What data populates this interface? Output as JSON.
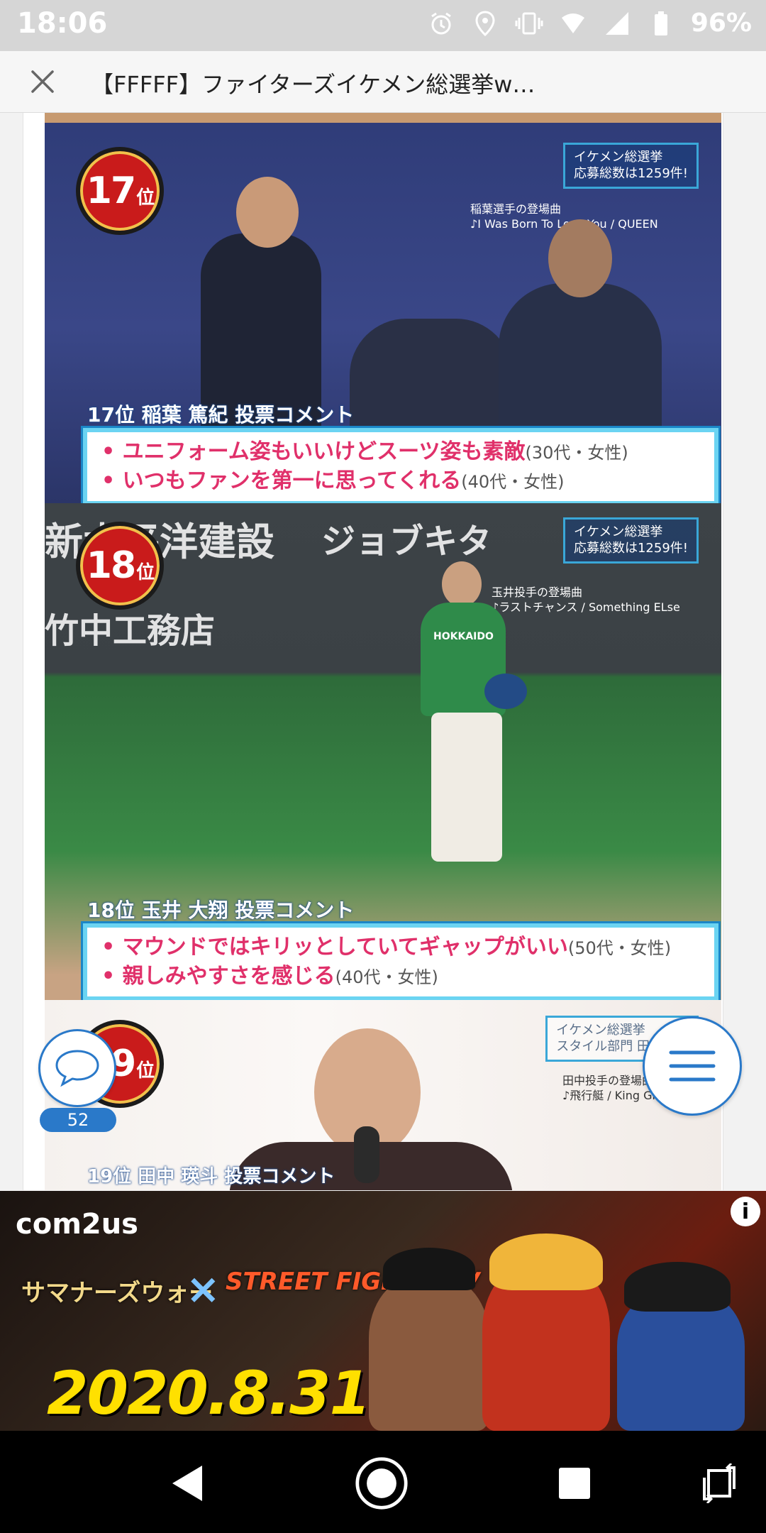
{
  "status_bar": {
    "time": "18:06",
    "battery": "96%",
    "icons": [
      "alarm-icon",
      "location-icon",
      "vibrate-icon",
      "wifi-icon",
      "signal-icon",
      "battery-icon"
    ]
  },
  "header": {
    "title": "【FFFFF】ファイターズイケメン総選挙w…"
  },
  "panels": {
    "p17": {
      "rank_num": "17",
      "rank_suffix": "位",
      "tag_line1": "イケメン総選挙",
      "tag_line2": "応募総数は1259件!",
      "song_label": "稲葉選手の登場曲",
      "song_title": "♪I Was Born To Love You / QUEEN",
      "comment_head": "17位 稲葉 篤紀 投票コメント",
      "comments": [
        {
          "text": "• ユニフォーム姿もいいけどスーツ姿も素敵",
          "meta": "(30代・女性)"
        },
        {
          "text": "• いつもファンを第一に思ってくれる",
          "meta": "(40代・女性)"
        }
      ]
    },
    "p18": {
      "rank_num": "18",
      "rank_suffix": "位",
      "tag_line1": "イケメン総選挙",
      "tag_line2": "応募総数は1259件!",
      "song_label": "玉井投手の登場曲",
      "song_title": "♪ラストチャンス / Something ELse",
      "sponsor1": "新太平洋建設",
      "sponsor2": "ジョブキタ",
      "sponsor3": "竹中工務店",
      "jersey": "HOKKAIDO",
      "comment_head": "18位 玉井 大翔 投票コメント",
      "comments": [
        {
          "text": "• マウンドではキリッとしていてギャップがいい",
          "meta": "(50代・女性)"
        },
        {
          "text": "• 親しみやすさを感じる",
          "meta": "(40代・女性)"
        }
      ]
    },
    "p19": {
      "rank_num": "19",
      "rank_suffix": "位",
      "tag_line1": "イケメン総選挙",
      "tag_line2": "スタイル部門 田中瑛斗",
      "song_label": "田中投手の登場曲",
      "song_title": "♪飛行艇 / King Gnu",
      "comment_head": "19位 田中 瑛斗 投票コメント"
    }
  },
  "floating": {
    "comment_count": "52"
  },
  "ad": {
    "brand": "com2us",
    "game": "サマナーズウォー",
    "x": "×",
    "collab": "STREET FIGHTER V",
    "date": "2020.8.31",
    "info": "i"
  },
  "colors": {
    "accent_blue": "#2a79c9",
    "comment_pink": "#e0306a",
    "ad_date_yellow": "#ffe000"
  }
}
